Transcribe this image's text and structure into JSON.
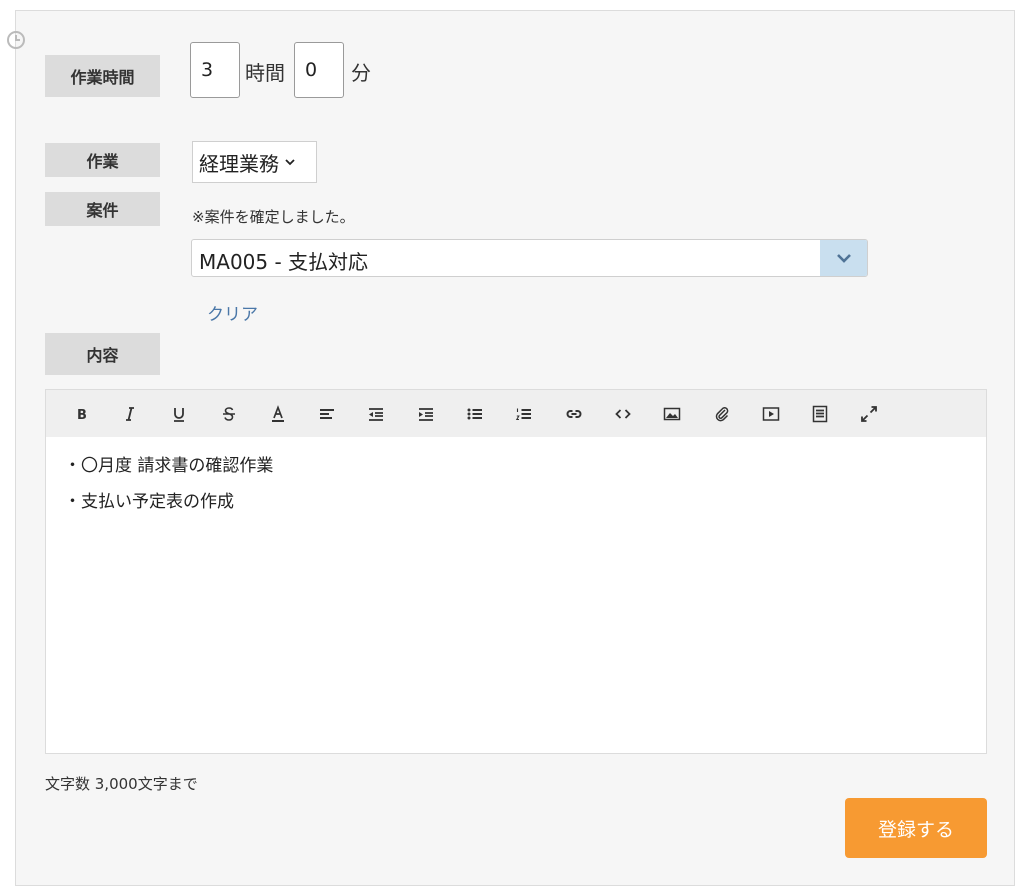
{
  "work_time": {
    "label": "作業時間",
    "hours_value": "3",
    "hours_unit": "時間",
    "minutes_value": "0",
    "minutes_unit": "分"
  },
  "work": {
    "label": "作業",
    "selected": "経理業務"
  },
  "case": {
    "label": "案件",
    "note": "※案件を確定しました。",
    "selected": "MA005 - 支払対応",
    "clear_label": "クリア"
  },
  "content": {
    "label": "内容",
    "toolbar_icons": [
      "bold-icon",
      "italic-icon",
      "underline-icon",
      "strikethrough-icon",
      "font-color-icon",
      "align-left-icon",
      "outdent-icon",
      "indent-icon",
      "bullet-list-icon",
      "numbered-list-icon",
      "link-icon",
      "code-icon",
      "image-icon",
      "attachment-icon",
      "video-icon",
      "justify-icon",
      "fullscreen-icon"
    ],
    "lines": [
      "・〇月度 請求書の確認作業",
      "・支払い予定表の作成"
    ],
    "char_limit": "文字数 3,000文字まで"
  },
  "submit_label": "登録する",
  "colors": {
    "accent": "#f79a32",
    "link": "#4a77a8",
    "dropdown_btn": "#c9dfef"
  }
}
